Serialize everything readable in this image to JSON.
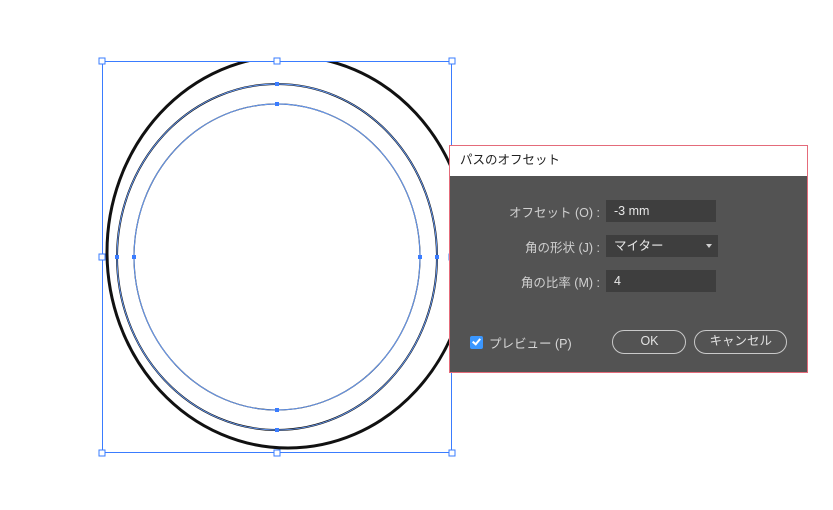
{
  "dialog": {
    "title": "パスのオフセット",
    "offset": {
      "label": "オフセット (O) :",
      "value": "-3 mm"
    },
    "joins": {
      "label": "角の形状 (J) :",
      "value": "マイター"
    },
    "miter": {
      "label": "角の比率 (M) :",
      "value": "4"
    },
    "preview_label": "プレビュー (P)",
    "ok_label": "OK",
    "cancel_label": "キャンセル"
  }
}
